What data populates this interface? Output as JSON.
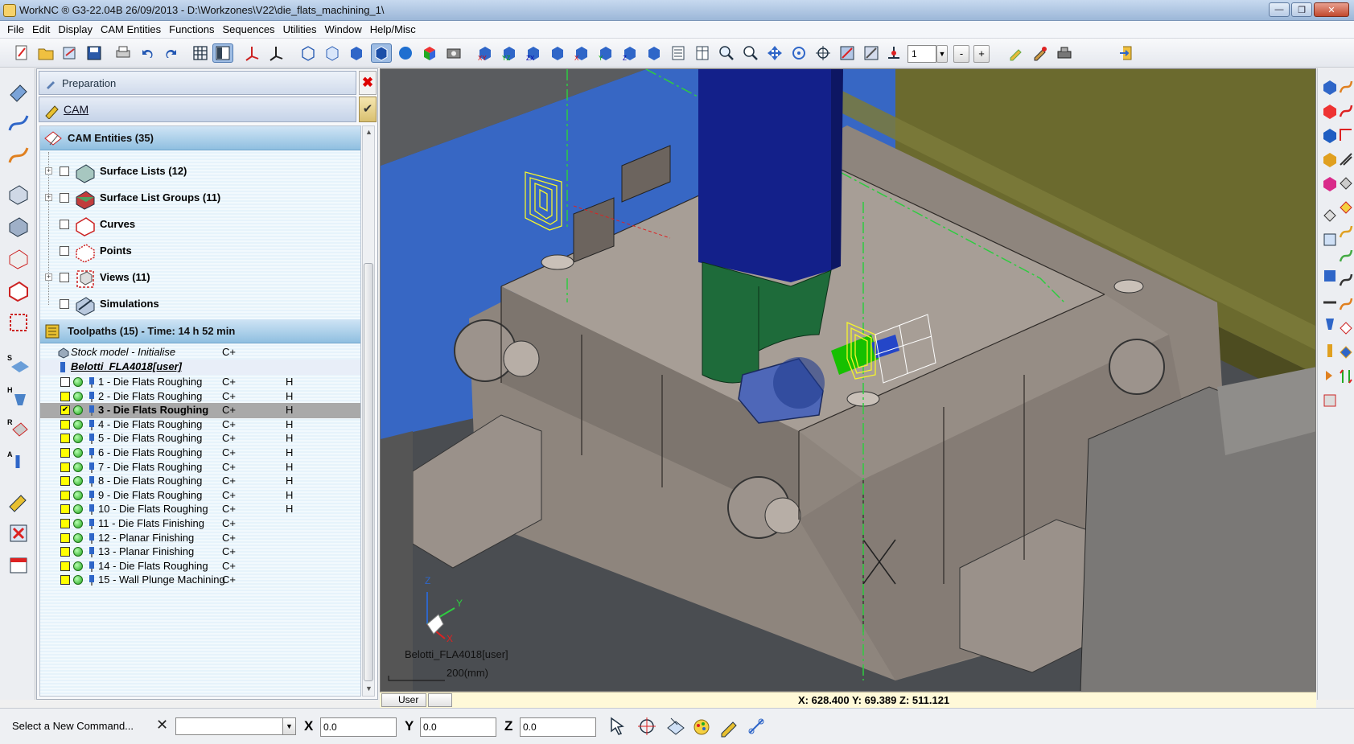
{
  "window": {
    "title": "WorkNC ® G3-22.04B   26/09/2013 - D:\\Workzones\\V22\\die_flats_machining_1\\"
  },
  "menu": [
    "File",
    "Edit",
    "Display",
    "CAM Entities",
    "Functions",
    "Sequences",
    "Utilities",
    "Window",
    "Help/Misc"
  ],
  "toolbar": {
    "view_number": "1",
    "minus_label": "-",
    "plus_label": "+"
  },
  "panel": {
    "header": "Preparation",
    "close_label": "✖",
    "cam_label": "CAM",
    "cam_check": "✔",
    "sections": {
      "entities": "CAM Entities (35)",
      "toolpaths": "Toolpaths (15) - Time: 14 h 52 min"
    },
    "entities": [
      {
        "label": "Surface Lists (12)",
        "expandable": true
      },
      {
        "label": "Surface List Groups (11)",
        "expandable": true
      },
      {
        "label": "Curves",
        "expandable": false
      },
      {
        "label": "Points",
        "expandable": false
      },
      {
        "label": "Views (11)",
        "expandable": true
      },
      {
        "label": "Simulations",
        "expandable": false
      }
    ],
    "stock_model": {
      "label": "Stock model - Initialise",
      "c": "C+"
    },
    "machine": "Belotti_FLA4018[user]",
    "toolpaths": [
      {
        "label": "1 - Die Flats Roughing",
        "c": "C+",
        "h": "H",
        "checked": false,
        "yellow": false
      },
      {
        "label": "2 - Die Flats Roughing",
        "c": "C+",
        "h": "H",
        "checked": false,
        "yellow": true
      },
      {
        "label": "3 - Die Flats Roughing",
        "c": "C+",
        "h": "H",
        "checked": true,
        "yellow": true,
        "selected": true
      },
      {
        "label": "4 - Die Flats Roughing",
        "c": "C+",
        "h": "H",
        "checked": false,
        "yellow": true
      },
      {
        "label": "5 - Die Flats Roughing",
        "c": "C+",
        "h": "H",
        "checked": false,
        "yellow": true
      },
      {
        "label": "6 - Die Flats Roughing",
        "c": "C+",
        "h": "H",
        "checked": false,
        "yellow": true
      },
      {
        "label": "7 - Die Flats Roughing",
        "c": "C+",
        "h": "H",
        "checked": false,
        "yellow": true
      },
      {
        "label": "8 - Die Flats Roughing",
        "c": "C+",
        "h": "H",
        "checked": false,
        "yellow": true
      },
      {
        "label": "9 - Die Flats Roughing",
        "c": "C+",
        "h": "H",
        "checked": false,
        "yellow": true
      },
      {
        "label": "10 - Die Flats Roughing",
        "c": "C+",
        "h": "H",
        "checked": false,
        "yellow": true
      },
      {
        "label": "11 - Die Flats Finishing",
        "c": "C+",
        "h": "",
        "checked": false,
        "yellow": true
      },
      {
        "label": "12 - Planar Finishing",
        "c": "C+",
        "h": "",
        "checked": false,
        "yellow": true
      },
      {
        "label": "13 - Planar Finishing",
        "c": "C+",
        "h": "",
        "checked": false,
        "yellow": true
      },
      {
        "label": "14 - Die Flats Roughing",
        "c": "C+",
        "h": "",
        "checked": false,
        "yellow": true
      },
      {
        "label": "15 - Wall Plunge Machining",
        "c": "C+",
        "h": "",
        "checked": false,
        "yellow": true
      }
    ]
  },
  "viewport": {
    "axis_z": "Z",
    "axis_y": "Y",
    "axis_x": "X",
    "machine_label": "Belotti_FLA4018[user]",
    "scale_label": "200(mm)",
    "coords": "X: 628.400   Y: 69.389   Z: 511.121",
    "user_button": "User"
  },
  "status": {
    "prompt": "Select a New Command...",
    "x_label": "X",
    "y_label": "Y",
    "z_label": "Z",
    "x_value": "0.0",
    "y_value": "0.0",
    "z_value": "0.0"
  },
  "colors": {
    "spindle_blue": "#13208a",
    "head_green": "#1e6b3a",
    "part_gray": "#9a918a",
    "accent_yellow": "#f5f52a"
  }
}
